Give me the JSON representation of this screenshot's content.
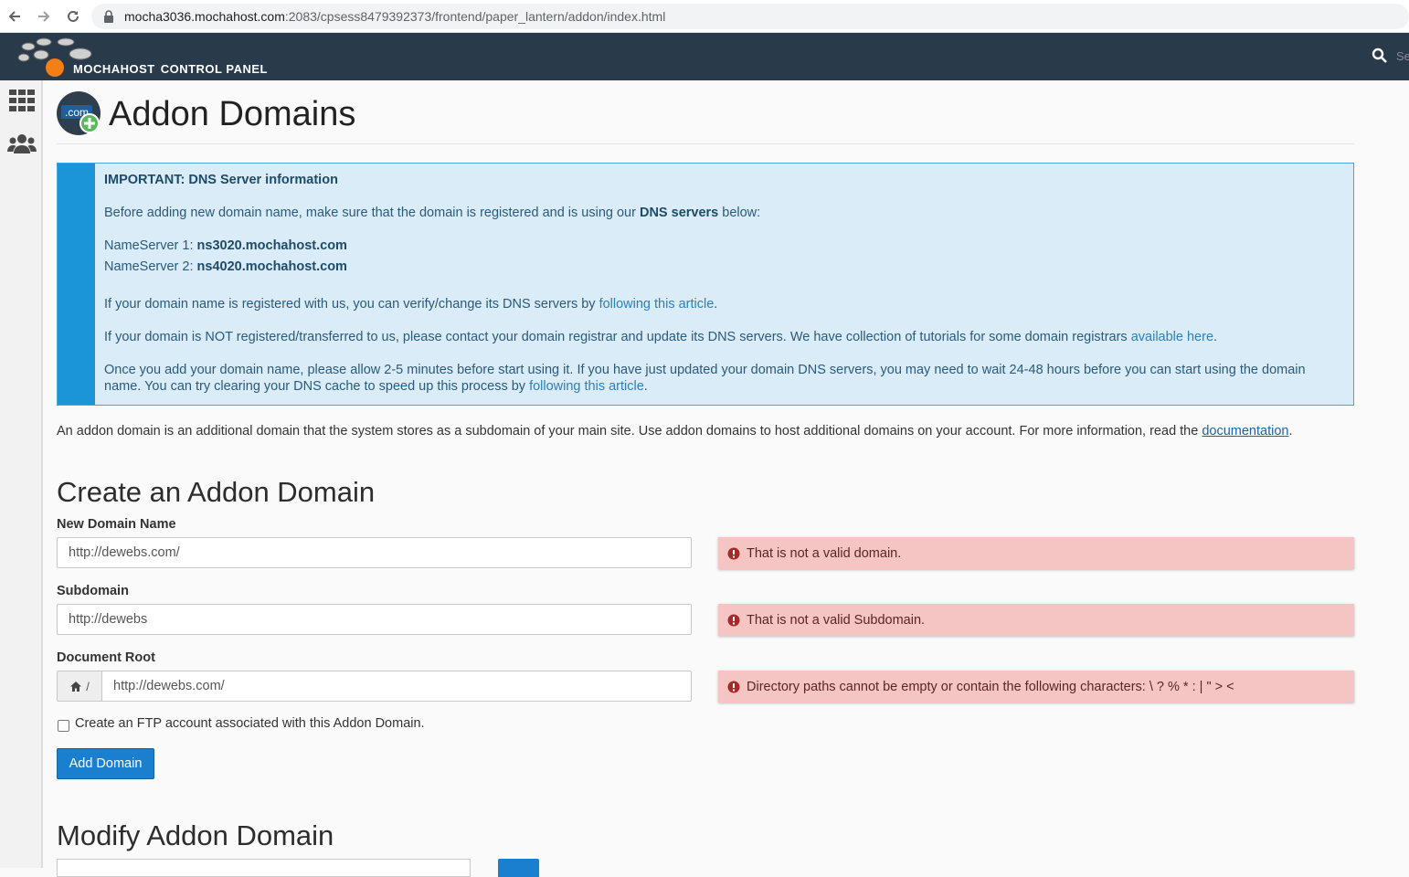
{
  "browser": {
    "url_host": "mocha3036.mochahost.com",
    "url_path": ":2083/cpsess8479392373/frontend/paper_lantern/addon/index.html"
  },
  "header": {
    "brand": "MOCHAHOST",
    "product": "CONTROL PANEL",
    "search_stub": "Se"
  },
  "page": {
    "title": "Addon Domains",
    "icon_text": ".com"
  },
  "alert": {
    "heading": "IMPORTANT: DNS Server information",
    "intro_before": "Before adding new domain name, make sure that the domain is registered and is using our ",
    "intro_bold": "DNS servers",
    "intro_after": " below:",
    "ns1_label": "NameServer 1: ",
    "ns1_value": "ns3020.mochahost.com",
    "ns2_label": "NameServer 2: ",
    "ns2_value": "ns4020.mochahost.com",
    "registered_text": "If your domain name is registered with us, you can verify/change its DNS servers by ",
    "registered_link": "following this article",
    "registered_end": ".",
    "not_registered_text": "If your domain is NOT registered/transferred to us, please contact your domain registrar and update its DNS servers. We have collection of tutorials for some domain registrars ",
    "not_registered_link": "available here",
    "not_registered_end": ".",
    "wait_text_1": "Once you add your domain name, please allow 2-5 minutes before start using it. If you have just updated your domain DNS servers, you may need to wait 24-48 hours before you can start using the domain",
    "wait_text_2": "name. You can try clearing your DNS cache to speed up this process by ",
    "wait_link": "following this article",
    "wait_end": "."
  },
  "description": {
    "text": "An addon domain is an additional domain that the system stores as a subdomain of your main site. Use addon domains to host additional domains on your account. For more information, read the ",
    "link": "documentation",
    "end": "."
  },
  "create_form": {
    "heading": "Create an Addon Domain",
    "domain_label": "New Domain Name",
    "domain_value": "http://dewebs.com/",
    "domain_error": "That is not a valid domain.",
    "subdomain_label": "Subdomain",
    "subdomain_value": "http://dewebs",
    "subdomain_error": "That is not a valid Subdomain.",
    "docroot_label": "Document Root",
    "docroot_prefix": "/",
    "docroot_value": "http://dewebs.com/",
    "docroot_error": "Directory paths cannot be empty or contain the following characters: \\ ? % * : | \" > <",
    "ftp_label": "Create an FTP account associated with this Addon Domain.",
    "ftp_checked": false,
    "submit_label": "Add Domain"
  },
  "modify_section": {
    "heading": "Modify Addon Domain"
  },
  "colors": {
    "header_bg": "#293a4a",
    "alert_bg": "#d9ecf8",
    "alert_bar": "#1b95d8",
    "error_bg": "#f5c5c4",
    "primary": "#1b7fd0"
  }
}
